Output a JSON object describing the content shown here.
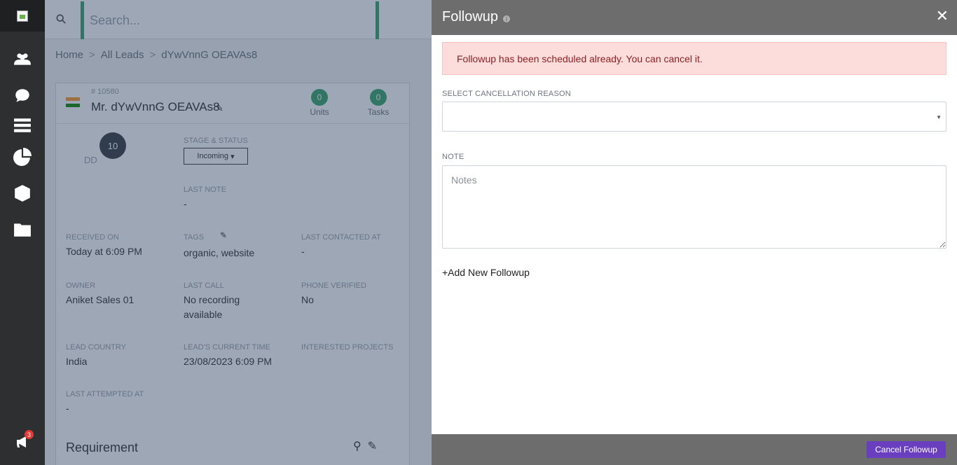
{
  "search": {
    "placeholder": "Search..."
  },
  "breadcrumb": {
    "items": [
      "Home",
      "All Leads",
      "dYwVnnG OEAVAs8"
    ]
  },
  "lead": {
    "id": "# 10580",
    "name": "Mr. dYwVnnG OEAVAs8",
    "units": {
      "count": "0",
      "label": "Units"
    },
    "tasks": {
      "count": "0",
      "label": "Tasks"
    },
    "score": "10",
    "score_sub": "DD",
    "stage_label": "STAGE & STATUS",
    "stage_value": "Incoming",
    "last_note_label": "LAST NOTE",
    "last_note_value": "-",
    "received_label": "RECEIVED ON",
    "received_value": "Today at 6:09 PM",
    "tags_label": "TAGS",
    "tags_value": "organic, website",
    "last_contacted_label": "LAST CONTACTED AT",
    "last_contacted_value": "-",
    "owner_label": "OWNER",
    "owner_value": "Aniket Sales 01",
    "last_call_label": "LAST CALL",
    "last_call_value_1": "No recording",
    "last_call_value_2": "available",
    "phone_verified_label": "PHONE VERIFIED",
    "phone_verified_value": "No",
    "country_label": "LEAD COUNTRY",
    "country_value": "India",
    "current_time_label": "LEAD'S CURRENT TIME",
    "current_time_value": "23/08/2023 6:09 PM",
    "projects_label": "INTERESTED PROJECTS",
    "last_attempted_label": "LAST ATTEMPTED AT",
    "last_attempted_value": "-",
    "requirement_title": "Requirement"
  },
  "notifications": {
    "count": "3"
  },
  "modal": {
    "title": "Followup",
    "alert": "Followup has been scheduled already. You can cancel it.",
    "reason_label": "SELECT CANCELLATION REASON",
    "reason_value": "",
    "note_label": "NOTE",
    "note_placeholder": "Notes",
    "add_followup": "+Add New Followup",
    "cancel_button": "Cancel Followup"
  },
  "colors": {
    "accent_green": "#3aa76d",
    "modal_header": "#6d6d6d",
    "alert_bg": "#fddcdc",
    "cancel_button": "#6a3fbf",
    "sidebar": "#2e2f30"
  }
}
